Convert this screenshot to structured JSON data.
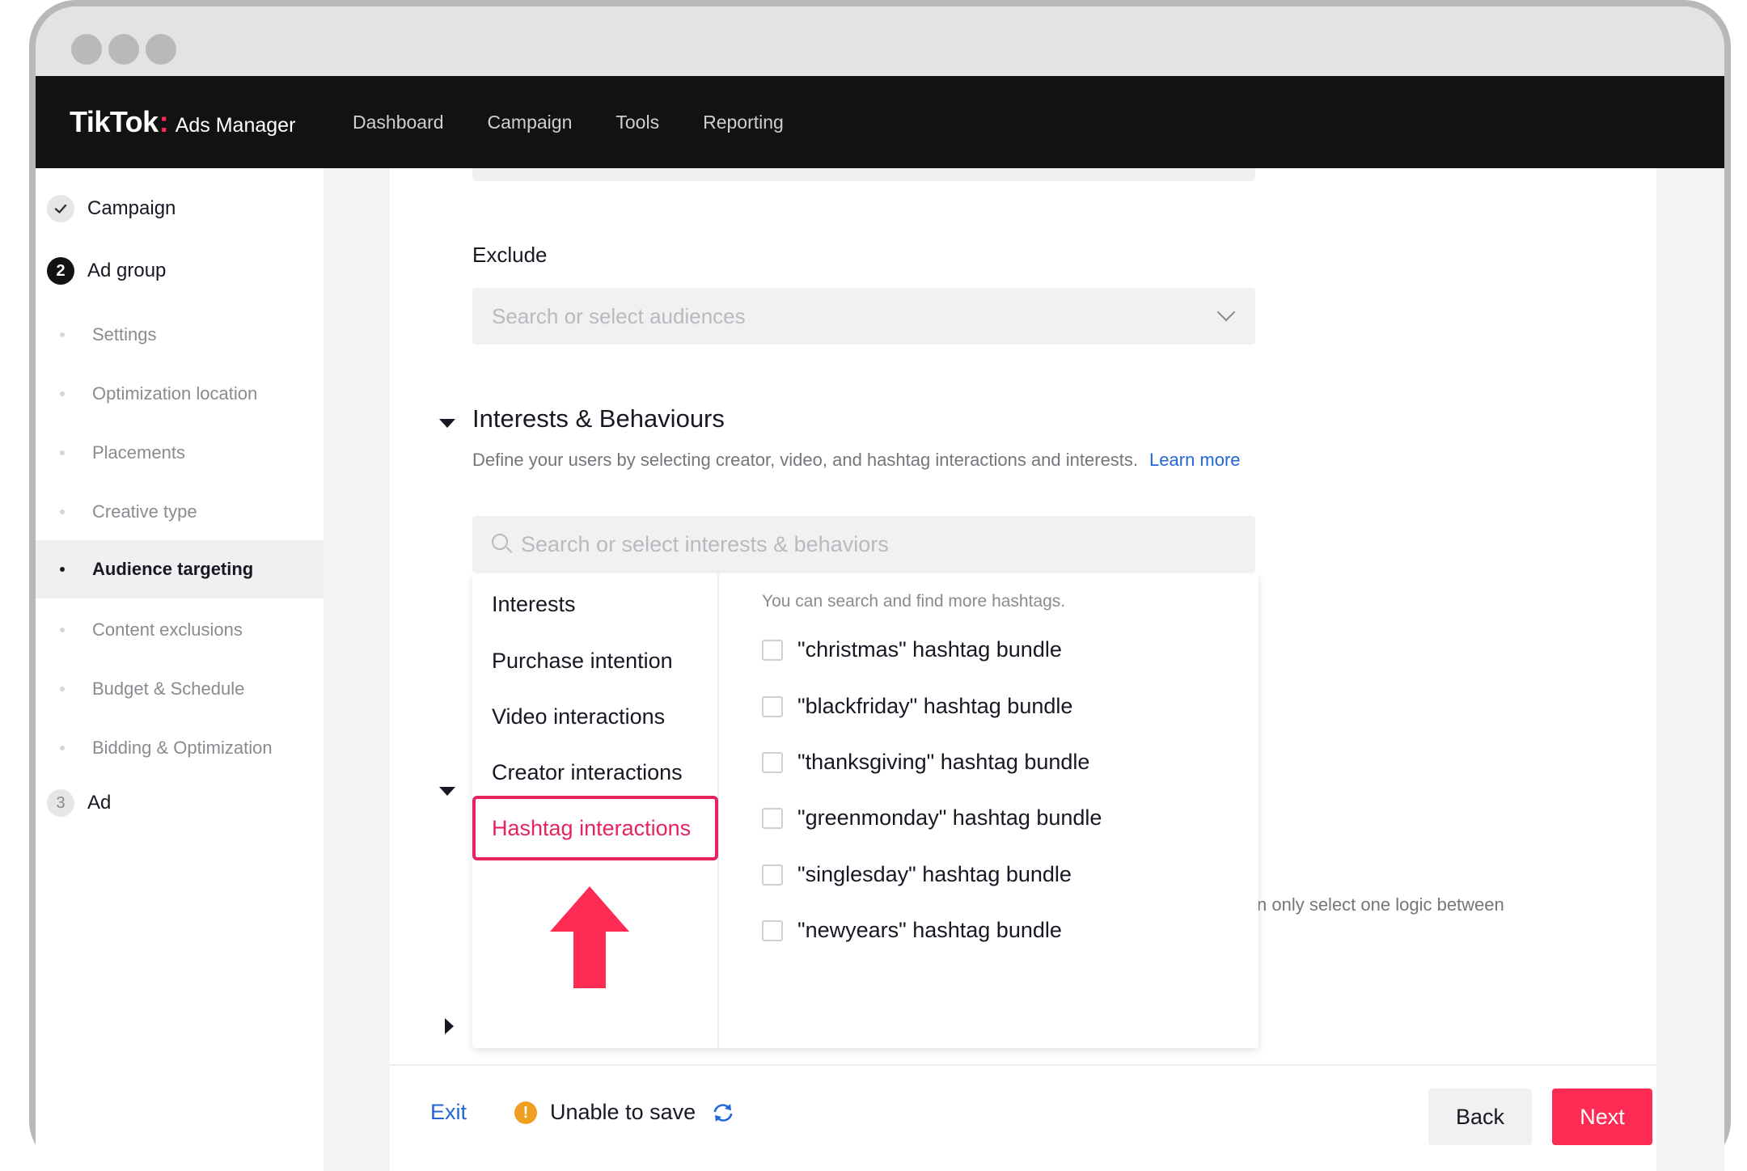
{
  "nav": {
    "brand": "TikTok",
    "brand_colon": ":",
    "product": "Ads Manager",
    "links": [
      "Dashboard",
      "Campaign",
      "Tools",
      "Reporting"
    ]
  },
  "sidebar": {
    "steps": [
      {
        "label": "Campaign",
        "state": "done",
        "badge": "✓"
      },
      {
        "label": "Ad group",
        "state": "active",
        "badge": "2"
      },
      {
        "label": "Ad",
        "state": "todo",
        "badge": "3"
      }
    ],
    "subitems": [
      {
        "label": "Settings"
      },
      {
        "label": "Optimization location"
      },
      {
        "label": "Placements"
      },
      {
        "label": "Creative type"
      },
      {
        "label": "Audience targeting",
        "active": true
      },
      {
        "label": "Content exclusions"
      },
      {
        "label": "Budget & Schedule"
      },
      {
        "label": "Bidding & Optimization"
      }
    ]
  },
  "main": {
    "exclude_title": "Exclude",
    "exclude_placeholder": "Search or select audiences",
    "interests_title": "Interests & Behaviours",
    "interests_desc": "Define your users by selecting creator, video, and hashtag interactions and interests.",
    "learn_more": "Learn more",
    "interests_placeholder": "Search or select interests & behaviors",
    "partial_note": "n only select one logic between"
  },
  "dropdown": {
    "categories": [
      "Interests",
      "Purchase intention",
      "Video interactions",
      "Creator interactions"
    ],
    "active_category": "Hashtag interactions",
    "hint": "You can search and find more hashtags.",
    "options": [
      {
        "label": "\"christmas\" hashtag bundle",
        "checked": false
      },
      {
        "label": "\"blackfriday\" hashtag bundle",
        "checked": false
      },
      {
        "label": "\"thanksgiving\" hashtag bundle",
        "checked": false
      },
      {
        "label": "\"greenmonday\" hashtag bundle",
        "checked": false
      },
      {
        "label": "\"singlesday\" hashtag bundle",
        "checked": false
      },
      {
        "label": "\"newyears\" hashtag bundle",
        "checked": false
      }
    ]
  },
  "footer": {
    "exit": "Exit",
    "warning_icon": "!",
    "status": "Unable to save",
    "back": "Back",
    "next": "Next"
  },
  "colors": {
    "brand_pink": "#fe2c55",
    "highlight_pink": "#e5245e",
    "link_blue": "#2266d9",
    "nav_bg": "#121212",
    "warning": "#f0a020"
  },
  "icons": [
    "check-icon",
    "chevron-down-icon",
    "search-icon",
    "caret-down-icon",
    "caret-right-icon",
    "warning-icon",
    "refresh-icon",
    "up-arrow-annotation"
  ]
}
